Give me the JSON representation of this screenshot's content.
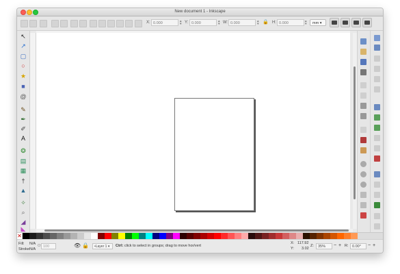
{
  "window": {
    "title": "New document 1 - Inkscape"
  },
  "toolbar": {
    "x_label": "X:",
    "x_value": "0.000",
    "y_label": "Y:",
    "y_value": "0.000",
    "w_label": "W:",
    "w_value": "0.000",
    "h_label": "H:",
    "h_value": "0.000",
    "unit": "mm ▾"
  },
  "tools": [
    {
      "name": "selector-tool",
      "glyph": "↖",
      "color": "#222"
    },
    {
      "name": "node-tool",
      "glyph": "↗",
      "color": "#2a6fcf"
    },
    {
      "name": "rectangle-tool",
      "glyph": "▢",
      "color": "#3b6dc0"
    },
    {
      "name": "ellipse-tool",
      "glyph": "○",
      "color": "#cc2f2f"
    },
    {
      "name": "star-tool",
      "glyph": "★",
      "color": "#d6a400"
    },
    {
      "name": "3dbox-tool",
      "glyph": "■",
      "color": "#4a63b5"
    },
    {
      "name": "spiral-tool",
      "glyph": "@",
      "color": "#555"
    },
    {
      "name": "pencil-tool",
      "glyph": "✎",
      "color": "#6b4e1e"
    },
    {
      "name": "pen-tool",
      "glyph": "✒",
      "color": "#2f6c2f"
    },
    {
      "name": "calligraphy-tool",
      "glyph": "✐",
      "color": "#444"
    },
    {
      "name": "text-tool",
      "glyph": "A",
      "color": "#111"
    },
    {
      "name": "spray-tool",
      "glyph": "❂",
      "color": "#3a8f3a"
    },
    {
      "name": "gradient-tool",
      "glyph": "▤",
      "color": "#2b8f5a"
    },
    {
      "name": "mesh-tool",
      "glyph": "▦",
      "color": "#2b8f5a"
    },
    {
      "name": "dropper-tool",
      "glyph": "†",
      "color": "#333"
    },
    {
      "name": "paint-bucket-tool",
      "glyph": "▲",
      "color": "#2f6c8f"
    },
    {
      "name": "tweak-tool",
      "glyph": "✧",
      "color": "#3f7f3f"
    },
    {
      "name": "zoom-tool",
      "glyph": "⌕",
      "color": "#666"
    },
    {
      "name": "measure-tool",
      "glyph": "◢",
      "color": "#7a3f9a"
    },
    {
      "name": "connector-tool",
      "glyph": "◣",
      "color": "#c54cc5"
    }
  ],
  "status": {
    "fill_label": "Fill:",
    "fill_value": "N/A",
    "stroke_label": "Stroke:",
    "stroke_value": "N/A",
    "opacity_label": "O:",
    "opacity_value": "100",
    "layer": "•Layer 1 ▾",
    "message_strong": "Ctrl:",
    "message": " click to select in groups; drag to move hor/vert",
    "x_label": "X:",
    "x_value": "117.92",
    "y_label": "Y:",
    "y_value": "3.02",
    "zoom_label": "Z:",
    "zoom_value": "35%",
    "rotation_label": "R:",
    "rotation_value": "0.00°"
  },
  "palette_colors": [
    "#000000",
    "#1a1a1a",
    "#333333",
    "#4d4d4d",
    "#666666",
    "#808080",
    "#999999",
    "#b3b3b3",
    "#cccccc",
    "#e6e6e6",
    "#ffffff",
    "#800000",
    "#ff0000",
    "#808000",
    "#ffff00",
    "#008000",
    "#00ff00",
    "#008080",
    "#00ffff",
    "#000080",
    "#0000ff",
    "#800080",
    "#ff00ff",
    "#2b0000",
    "#550000",
    "#800000",
    "#aa0000",
    "#d40000",
    "#ff0000",
    "#ff2a2a",
    "#ff5555",
    "#ff8080",
    "#ffaaaa",
    "#280b0b",
    "#501616",
    "#782121",
    "#a02c2c",
    "#c83737",
    "#d35f5f",
    "#de8787",
    "#e9afaf",
    "#2b1100",
    "#552200",
    "#803300",
    "#aa4400",
    "#d45500",
    "#ff6600",
    "#ff7f2a",
    "#ff9955"
  ]
}
